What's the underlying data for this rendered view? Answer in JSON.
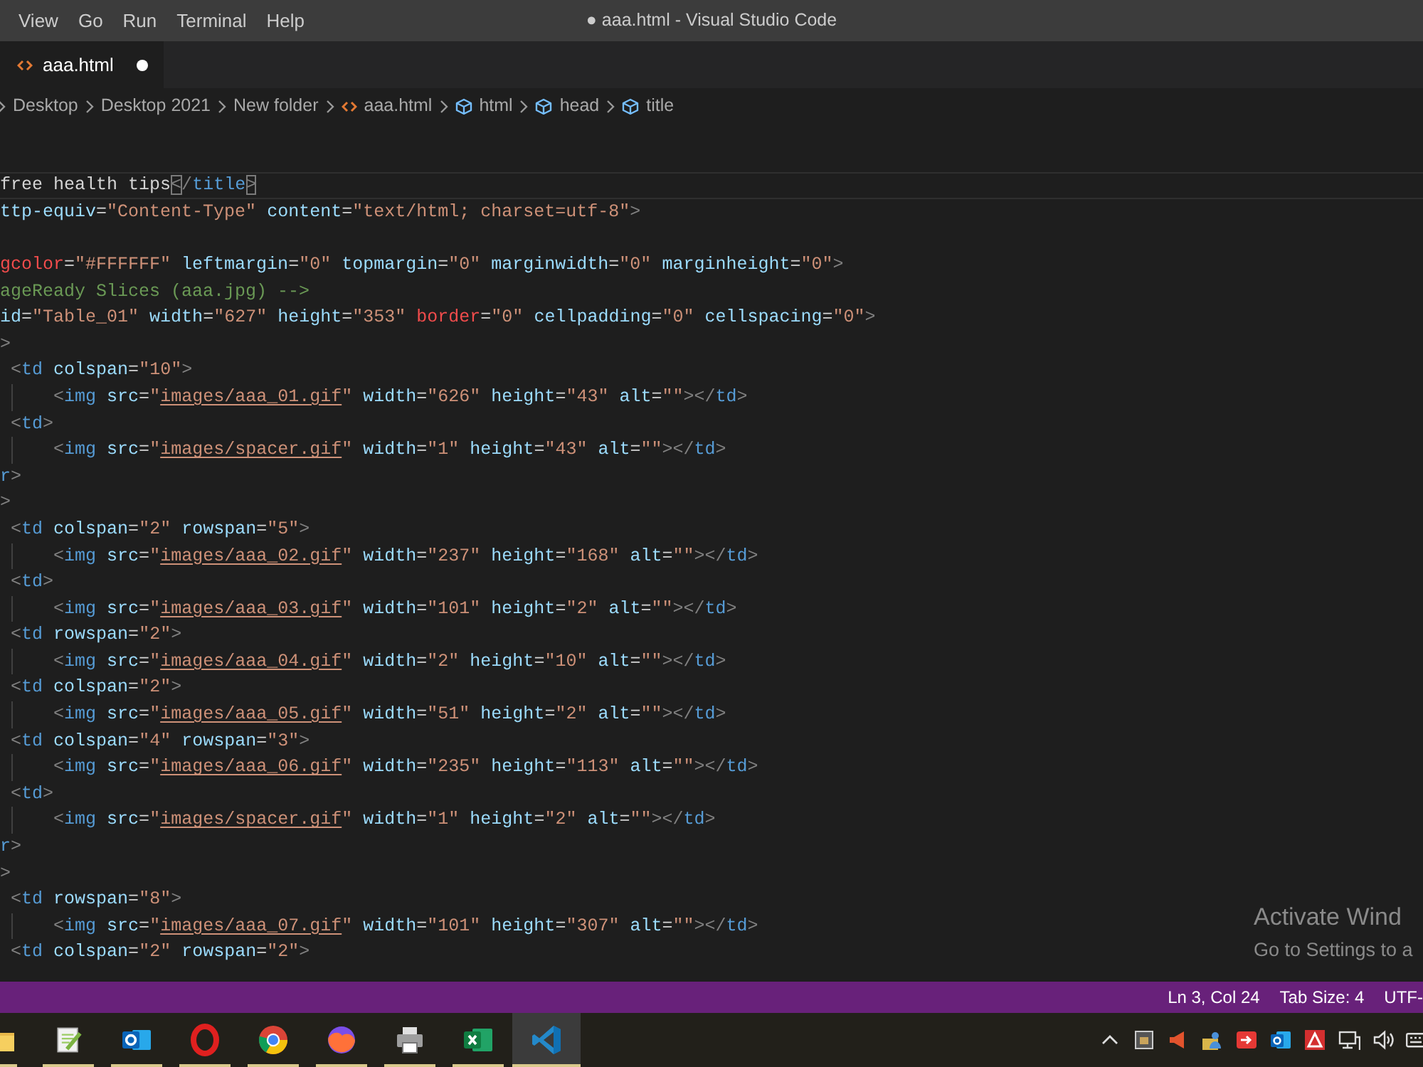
{
  "title_bar": {
    "menu": [
      "View",
      "Go",
      "Run",
      "Terminal",
      "Help"
    ],
    "title": "● aaa.html - Visual Studio Code"
  },
  "tabs": [
    {
      "label": "aaa.html",
      "selected": true,
      "modified": true
    }
  ],
  "breadcrumbs": [
    {
      "label": "Desktop",
      "kind": "folder"
    },
    {
      "label": "Desktop 2021",
      "kind": "folder"
    },
    {
      "label": "New folder",
      "kind": "folder"
    },
    {
      "label": "aaa.html",
      "kind": "file"
    },
    {
      "label": "html",
      "kind": "symbol"
    },
    {
      "label": "head",
      "kind": "symbol"
    },
    {
      "label": "title",
      "kind": "symbol"
    }
  ],
  "editor": {
    "lines": [
      {
        "current": true,
        "tokens": [
          {
            "kind": "text",
            "text": "free health tips"
          },
          {
            "kind": "match",
            "text": "<"
          },
          {
            "kind": "bracket",
            "text": "/"
          },
          {
            "kind": "tag",
            "text": "title"
          },
          {
            "kind": "match",
            "text": ">"
          }
        ]
      },
      {
        "current": false,
        "tokens": [
          {
            "kind": "attr",
            "text": "ttp-equiv"
          },
          {
            "kind": "eq",
            "text": "="
          },
          {
            "kind": "string",
            "text": "\"Content-Type\""
          },
          {
            "kind": "attr",
            "text": " content"
          },
          {
            "kind": "eq",
            "text": "="
          },
          {
            "kind": "string",
            "text": "\"text/html; charset=utf-8\""
          },
          {
            "kind": "bracket",
            "text": ">"
          }
        ]
      },
      {
        "current": false
      },
      {
        "current": false,
        "tokens": [
          {
            "kind": "deprecated",
            "text": "gcolor"
          },
          {
            "kind": "eq",
            "text": "="
          },
          {
            "kind": "string",
            "text": "\"#FFFFFF\""
          },
          {
            "kind": "attr",
            "text": " leftmargin"
          },
          {
            "kind": "eq",
            "text": "="
          },
          {
            "kind": "string",
            "text": "\"0\""
          },
          {
            "kind": "attr",
            "text": " topmargin"
          },
          {
            "kind": "eq",
            "text": "="
          },
          {
            "kind": "string",
            "text": "\"0\""
          },
          {
            "kind": "attr",
            "text": " marginwidth"
          },
          {
            "kind": "eq",
            "text": "="
          },
          {
            "kind": "string",
            "text": "\"0\""
          },
          {
            "kind": "attr",
            "text": " marginheight"
          },
          {
            "kind": "eq",
            "text": "="
          },
          {
            "kind": "string",
            "text": "\"0\""
          },
          {
            "kind": "bracket",
            "text": ">"
          }
        ]
      },
      {
        "current": false,
        "tokens": [
          {
            "kind": "comment",
            "text": "ageReady Slices (aaa.jpg) -->"
          }
        ]
      },
      {
        "current": false,
        "tokens": [
          {
            "kind": "attr",
            "text": "id"
          },
          {
            "kind": "eq",
            "text": "="
          },
          {
            "kind": "string",
            "text": "\"Table_01\""
          },
          {
            "kind": "attr",
            "text": " width"
          },
          {
            "kind": "eq",
            "text": "="
          },
          {
            "kind": "string",
            "text": "\"627\""
          },
          {
            "kind": "attr",
            "text": " height"
          },
          {
            "kind": "eq",
            "text": "="
          },
          {
            "kind": "string",
            "text": "\"353\""
          },
          {
            "kind": "deprecated",
            "text": " border"
          },
          {
            "kind": "eq",
            "text": "="
          },
          {
            "kind": "string",
            "text": "\"0\""
          },
          {
            "kind": "attr",
            "text": " cellpadding"
          },
          {
            "kind": "eq",
            "text": "="
          },
          {
            "kind": "string",
            "text": "\"0\""
          },
          {
            "kind": "attr",
            "text": " cellspacing"
          },
          {
            "kind": "eq",
            "text": "="
          },
          {
            "kind": "string",
            "text": "\"0\""
          },
          {
            "kind": "bracket",
            "text": ">"
          }
        ]
      },
      {
        "current": false,
        "tokens": [
          {
            "kind": "bracket",
            "text": ">"
          }
        ],
        "children": [
          {
            "current": false,
            "tokens": [
              {
                "kind": "bracket",
                "text": "<"
              },
              {
                "kind": "tag",
                "text": "td"
              },
              {
                "kind": "attr",
                "text": " colspan"
              },
              {
                "kind": "eq",
                "text": "="
              },
              {
                "kind": "string",
                "text": "\"10\""
              },
              {
                "kind": "bracket",
                "text": ">"
              }
            ],
            "children": [
              {
                "current": false,
                "tokens": [
                  {
                    "kind": "bracket",
                    "text": "<"
                  },
                  {
                    "kind": "tag",
                    "text": "img"
                  },
                  {
                    "kind": "attr",
                    "text": " src"
                  },
                  {
                    "kind": "eq",
                    "text": "="
                  },
                  {
                    "kind": "string",
                    "text": "\""
                  },
                  {
                    "kind": "link",
                    "text": "images/aaa_01.gif"
                  },
                  {
                    "kind": "string",
                    "text": "\""
                  },
                  {
                    "kind": "attr",
                    "text": " width"
                  },
                  {
                    "kind": "eq",
                    "text": "="
                  },
                  {
                    "kind": "string",
                    "text": "\"626\""
                  },
                  {
                    "kind": "attr",
                    "text": " height"
                  },
                  {
                    "kind": "eq",
                    "text": "="
                  },
                  {
                    "kind": "string",
                    "text": "\"43\""
                  },
                  {
                    "kind": "attr",
                    "text": " alt"
                  },
                  {
                    "kind": "eq",
                    "text": "="
                  },
                  {
                    "kind": "string",
                    "text": "\"\""
                  },
                  {
                    "kind": "bracket",
                    "text": "></"
                  },
                  {
                    "kind": "tag",
                    "text": "td"
                  },
                  {
                    "kind": "bracket",
                    "text": ">"
                  }
                ]
              }
            ]
          },
          {
            "current": false,
            "tokens": [
              {
                "kind": "bracket",
                "text": "<"
              },
              {
                "kind": "tag",
                "text": "td"
              },
              {
                "kind": "bracket",
                "text": ">"
              }
            ],
            "children": [
              {
                "current": false,
                "tokens": [
                  {
                    "kind": "bracket",
                    "text": "<"
                  },
                  {
                    "kind": "tag",
                    "text": "img"
                  },
                  {
                    "kind": "attr",
                    "text": " src"
                  },
                  {
                    "kind": "eq",
                    "text": "="
                  },
                  {
                    "kind": "string",
                    "text": "\""
                  },
                  {
                    "kind": "link",
                    "text": "images/spacer.gif"
                  },
                  {
                    "kind": "string",
                    "text": "\""
                  },
                  {
                    "kind": "attr",
                    "text": " width"
                  },
                  {
                    "kind": "eq",
                    "text": "="
                  },
                  {
                    "kind": "string",
                    "text": "\"1\""
                  },
                  {
                    "kind": "attr",
                    "text": " height"
                  },
                  {
                    "kind": "eq",
                    "text": "="
                  },
                  {
                    "kind": "string",
                    "text": "\"43\""
                  },
                  {
                    "kind": "attr",
                    "text": " alt"
                  },
                  {
                    "kind": "eq",
                    "text": "="
                  },
                  {
                    "kind": "string",
                    "text": "\"\""
                  },
                  {
                    "kind": "bracket",
                    "text": "></"
                  },
                  {
                    "kind": "tag",
                    "text": "td"
                  },
                  {
                    "kind": "bracket",
                    "text": ">"
                  }
                ]
              }
            ]
          }
        ]
      },
      {
        "current": false,
        "tokens": [
          {
            "kind": "tag",
            "text": "r"
          },
          {
            "kind": "bracket",
            "text": ">"
          }
        ]
      },
      {
        "current": false,
        "tokens": [
          {
            "kind": "bracket",
            "text": ">"
          }
        ],
        "children": [
          {
            "current": false,
            "tokens": [
              {
                "kind": "bracket",
                "text": "<"
              },
              {
                "kind": "tag",
                "text": "td"
              },
              {
                "kind": "attr",
                "text": " colspan"
              },
              {
                "kind": "eq",
                "text": "="
              },
              {
                "kind": "string",
                "text": "\"2\""
              },
              {
                "kind": "attr",
                "text": " rowspan"
              },
              {
                "kind": "eq",
                "text": "="
              },
              {
                "kind": "string",
                "text": "\"5\""
              },
              {
                "kind": "bracket",
                "text": ">"
              }
            ],
            "children": [
              {
                "current": false,
                "tokens": [
                  {
                    "kind": "bracket",
                    "text": "<"
                  },
                  {
                    "kind": "tag",
                    "text": "img"
                  },
                  {
                    "kind": "attr",
                    "text": " src"
                  },
                  {
                    "kind": "eq",
                    "text": "="
                  },
                  {
                    "kind": "string",
                    "text": "\""
                  },
                  {
                    "kind": "link",
                    "text": "images/aaa_02.gif"
                  },
                  {
                    "kind": "string",
                    "text": "\""
                  },
                  {
                    "kind": "attr",
                    "text": " width"
                  },
                  {
                    "kind": "eq",
                    "text": "="
                  },
                  {
                    "kind": "string",
                    "text": "\"237\""
                  },
                  {
                    "kind": "attr",
                    "text": " height"
                  },
                  {
                    "kind": "eq",
                    "text": "="
                  },
                  {
                    "kind": "string",
                    "text": "\"168\""
                  },
                  {
                    "kind": "attr",
                    "text": " alt"
                  },
                  {
                    "kind": "eq",
                    "text": "="
                  },
                  {
                    "kind": "string",
                    "text": "\"\""
                  },
                  {
                    "kind": "bracket",
                    "text": "></"
                  },
                  {
                    "kind": "tag",
                    "text": "td"
                  },
                  {
                    "kind": "bracket",
                    "text": ">"
                  }
                ]
              }
            ]
          },
          {
            "current": false,
            "tokens": [
              {
                "kind": "bracket",
                "text": "<"
              },
              {
                "kind": "tag",
                "text": "td"
              },
              {
                "kind": "bracket",
                "text": ">"
              }
            ],
            "children": [
              {
                "current": false,
                "tokens": [
                  {
                    "kind": "bracket",
                    "text": "<"
                  },
                  {
                    "kind": "tag",
                    "text": "img"
                  },
                  {
                    "kind": "attr",
                    "text": " src"
                  },
                  {
                    "kind": "eq",
                    "text": "="
                  },
                  {
                    "kind": "string",
                    "text": "\""
                  },
                  {
                    "kind": "link",
                    "text": "images/aaa_03.gif"
                  },
                  {
                    "kind": "string",
                    "text": "\""
                  },
                  {
                    "kind": "attr",
                    "text": " width"
                  },
                  {
                    "kind": "eq",
                    "text": "="
                  },
                  {
                    "kind": "string",
                    "text": "\"101\""
                  },
                  {
                    "kind": "attr",
                    "text": " height"
                  },
                  {
                    "kind": "eq",
                    "text": "="
                  },
                  {
                    "kind": "string",
                    "text": "\"2\""
                  },
                  {
                    "kind": "attr",
                    "text": " alt"
                  },
                  {
                    "kind": "eq",
                    "text": "="
                  },
                  {
                    "kind": "string",
                    "text": "\"\""
                  },
                  {
                    "kind": "bracket",
                    "text": "></"
                  },
                  {
                    "kind": "tag",
                    "text": "td"
                  },
                  {
                    "kind": "bracket",
                    "text": ">"
                  }
                ]
              }
            ]
          },
          {
            "current": false,
            "tokens": [
              {
                "kind": "bracket",
                "text": "<"
              },
              {
                "kind": "tag",
                "text": "td"
              },
              {
                "kind": "attr",
                "text": " rowspan"
              },
              {
                "kind": "eq",
                "text": "="
              },
              {
                "kind": "string",
                "text": "\"2\""
              },
              {
                "kind": "bracket",
                "text": ">"
              }
            ],
            "children": [
              {
                "current": false,
                "tokens": [
                  {
                    "kind": "bracket",
                    "text": "<"
                  },
                  {
                    "kind": "tag",
                    "text": "img"
                  },
                  {
                    "kind": "attr",
                    "text": " src"
                  },
                  {
                    "kind": "eq",
                    "text": "="
                  },
                  {
                    "kind": "string",
                    "text": "\""
                  },
                  {
                    "kind": "link",
                    "text": "images/aaa_04.gif"
                  },
                  {
                    "kind": "string",
                    "text": "\""
                  },
                  {
                    "kind": "attr",
                    "text": " width"
                  },
                  {
                    "kind": "eq",
                    "text": "="
                  },
                  {
                    "kind": "string",
                    "text": "\"2\""
                  },
                  {
                    "kind": "attr",
                    "text": " height"
                  },
                  {
                    "kind": "eq",
                    "text": "="
                  },
                  {
                    "kind": "string",
                    "text": "\"10\""
                  },
                  {
                    "kind": "attr",
                    "text": " alt"
                  },
                  {
                    "kind": "eq",
                    "text": "="
                  },
                  {
                    "kind": "string",
                    "text": "\"\""
                  },
                  {
                    "kind": "bracket",
                    "text": "></"
                  },
                  {
                    "kind": "tag",
                    "text": "td"
                  },
                  {
                    "kind": "bracket",
                    "text": ">"
                  }
                ]
              }
            ]
          },
          {
            "current": false,
            "tokens": [
              {
                "kind": "bracket",
                "text": "<"
              },
              {
                "kind": "tag",
                "text": "td"
              },
              {
                "kind": "attr",
                "text": " colspan"
              },
              {
                "kind": "eq",
                "text": "="
              },
              {
                "kind": "string",
                "text": "\"2\""
              },
              {
                "kind": "bracket",
                "text": ">"
              }
            ],
            "children": [
              {
                "current": false,
                "tokens": [
                  {
                    "kind": "bracket",
                    "text": "<"
                  },
                  {
                    "kind": "tag",
                    "text": "img"
                  },
                  {
                    "kind": "attr",
                    "text": " src"
                  },
                  {
                    "kind": "eq",
                    "text": "="
                  },
                  {
                    "kind": "string",
                    "text": "\""
                  },
                  {
                    "kind": "link",
                    "text": "images/aaa_05.gif"
                  },
                  {
                    "kind": "string",
                    "text": "\""
                  },
                  {
                    "kind": "attr",
                    "text": " width"
                  },
                  {
                    "kind": "eq",
                    "text": "="
                  },
                  {
                    "kind": "string",
                    "text": "\"51\""
                  },
                  {
                    "kind": "attr",
                    "text": " height"
                  },
                  {
                    "kind": "eq",
                    "text": "="
                  },
                  {
                    "kind": "string",
                    "text": "\"2\""
                  },
                  {
                    "kind": "attr",
                    "text": " alt"
                  },
                  {
                    "kind": "eq",
                    "text": "="
                  },
                  {
                    "kind": "string",
                    "text": "\"\""
                  },
                  {
                    "kind": "bracket",
                    "text": "></"
                  },
                  {
                    "kind": "tag",
                    "text": "td"
                  },
                  {
                    "kind": "bracket",
                    "text": ">"
                  }
                ]
              }
            ]
          },
          {
            "current": false,
            "tokens": [
              {
                "kind": "bracket",
                "text": "<"
              },
              {
                "kind": "tag",
                "text": "td"
              },
              {
                "kind": "attr",
                "text": " colspan"
              },
              {
                "kind": "eq",
                "text": "="
              },
              {
                "kind": "string",
                "text": "\"4\""
              },
              {
                "kind": "attr",
                "text": " rowspan"
              },
              {
                "kind": "eq",
                "text": "="
              },
              {
                "kind": "string",
                "text": "\"3\""
              },
              {
                "kind": "bracket",
                "text": ">"
              }
            ],
            "children": [
              {
                "current": false,
                "tokens": [
                  {
                    "kind": "bracket",
                    "text": "<"
                  },
                  {
                    "kind": "tag",
                    "text": "img"
                  },
                  {
                    "kind": "attr",
                    "text": " src"
                  },
                  {
                    "kind": "eq",
                    "text": "="
                  },
                  {
                    "kind": "string",
                    "text": "\""
                  },
                  {
                    "kind": "link",
                    "text": "images/aaa_06.gif"
                  },
                  {
                    "kind": "string",
                    "text": "\""
                  },
                  {
                    "kind": "attr",
                    "text": " width"
                  },
                  {
                    "kind": "eq",
                    "text": "="
                  },
                  {
                    "kind": "string",
                    "text": "\"235\""
                  },
                  {
                    "kind": "attr",
                    "text": " height"
                  },
                  {
                    "kind": "eq",
                    "text": "="
                  },
                  {
                    "kind": "string",
                    "text": "\"113\""
                  },
                  {
                    "kind": "attr",
                    "text": " alt"
                  },
                  {
                    "kind": "eq",
                    "text": "="
                  },
                  {
                    "kind": "string",
                    "text": "\"\""
                  },
                  {
                    "kind": "bracket",
                    "text": "></"
                  },
                  {
                    "kind": "tag",
                    "text": "td"
                  },
                  {
                    "kind": "bracket",
                    "text": ">"
                  }
                ]
              }
            ]
          },
          {
            "current": false,
            "tokens": [
              {
                "kind": "bracket",
                "text": "<"
              },
              {
                "kind": "tag",
                "text": "td"
              },
              {
                "kind": "bracket",
                "text": ">"
              }
            ],
            "children": [
              {
                "current": false,
                "tokens": [
                  {
                    "kind": "bracket",
                    "text": "<"
                  },
                  {
                    "kind": "tag",
                    "text": "img"
                  },
                  {
                    "kind": "attr",
                    "text": " src"
                  },
                  {
                    "kind": "eq",
                    "text": "="
                  },
                  {
                    "kind": "string",
                    "text": "\""
                  },
                  {
                    "kind": "link",
                    "text": "images/spacer.gif"
                  },
                  {
                    "kind": "string",
                    "text": "\""
                  },
                  {
                    "kind": "attr",
                    "text": " width"
                  },
                  {
                    "kind": "eq",
                    "text": "="
                  },
                  {
                    "kind": "string",
                    "text": "\"1\""
                  },
                  {
                    "kind": "attr",
                    "text": " height"
                  },
                  {
                    "kind": "eq",
                    "text": "="
                  },
                  {
                    "kind": "string",
                    "text": "\"2\""
                  },
                  {
                    "kind": "attr",
                    "text": " alt"
                  },
                  {
                    "kind": "eq",
                    "text": "="
                  },
                  {
                    "kind": "string",
                    "text": "\"\""
                  },
                  {
                    "kind": "bracket",
                    "text": "></"
                  },
                  {
                    "kind": "tag",
                    "text": "td"
                  },
                  {
                    "kind": "bracket",
                    "text": ">"
                  }
                ]
              }
            ]
          }
        ]
      },
      {
        "current": false,
        "tokens": [
          {
            "kind": "tag",
            "text": "r"
          },
          {
            "kind": "bracket",
            "text": ">"
          }
        ]
      },
      {
        "current": false,
        "tokens": [
          {
            "kind": "bracket",
            "text": ">"
          }
        ],
        "children": [
          {
            "current": false,
            "tokens": [
              {
                "kind": "bracket",
                "text": "<"
              },
              {
                "kind": "tag",
                "text": "td"
              },
              {
                "kind": "attr",
                "text": " rowspan"
              },
              {
                "kind": "eq",
                "text": "="
              },
              {
                "kind": "string",
                "text": "\"8\""
              },
              {
                "kind": "bracket",
                "text": ">"
              }
            ],
            "children": [
              {
                "current": false,
                "tokens": [
                  {
                    "kind": "bracket",
                    "text": "<"
                  },
                  {
                    "kind": "tag",
                    "text": "img"
                  },
                  {
                    "kind": "attr",
                    "text": " src"
                  },
                  {
                    "kind": "eq",
                    "text": "="
                  },
                  {
                    "kind": "string",
                    "text": "\""
                  },
                  {
                    "kind": "link",
                    "text": "images/aaa_07.gif"
                  },
                  {
                    "kind": "string",
                    "text": "\""
                  },
                  {
                    "kind": "attr",
                    "text": " width"
                  },
                  {
                    "kind": "eq",
                    "text": "="
                  },
                  {
                    "kind": "string",
                    "text": "\"101\""
                  },
                  {
                    "kind": "attr",
                    "text": " height"
                  },
                  {
                    "kind": "eq",
                    "text": "="
                  },
                  {
                    "kind": "string",
                    "text": "\"307\""
                  },
                  {
                    "kind": "attr",
                    "text": " alt"
                  },
                  {
                    "kind": "eq",
                    "text": "="
                  },
                  {
                    "kind": "string",
                    "text": "\"\""
                  },
                  {
                    "kind": "bracket",
                    "text": "></"
                  },
                  {
                    "kind": "tag",
                    "text": "td"
                  },
                  {
                    "kind": "bracket",
                    "text": ">"
                  }
                ]
              }
            ]
          },
          {
            "current": false,
            "tokens": [
              {
                "kind": "bracket",
                "text": "<"
              },
              {
                "kind": "tag",
                "text": "td"
              },
              {
                "kind": "attr",
                "text": " colspan"
              },
              {
                "kind": "eq",
                "text": "="
              },
              {
                "kind": "string",
                "text": "\"2\""
              },
              {
                "kind": "attr",
                "text": " rowspan"
              },
              {
                "kind": "eq",
                "text": "="
              },
              {
                "kind": "string",
                "text": "\"2\""
              },
              {
                "kind": "bracket",
                "text": ">"
              }
            ]
          }
        ]
      }
    ]
  },
  "activation_notice": {
    "title": "Activate Wind",
    "text": "Go to Settings to a"
  },
  "status_bar": {
    "items": [
      "Ln 3, Col 24",
      "Tab Size: 4",
      "UTF-"
    ]
  },
  "taskbar": {
    "apps": [
      {
        "kind": "folder",
        "running": true,
        "selected": false
      },
      {
        "kind": "notepad",
        "running": true,
        "selected": false
      },
      {
        "kind": "mail",
        "running": true,
        "selected": false
      },
      {
        "kind": "ring",
        "running": true,
        "selected": false
      },
      {
        "kind": "wheel",
        "running": true,
        "selected": false
      },
      {
        "kind": "globe",
        "running": true,
        "selected": false
      },
      {
        "kind": "printer",
        "running": true,
        "selected": false
      },
      {
        "kind": "sheet",
        "running": true,
        "selected": false
      },
      {
        "kind": "ribbon",
        "running": true,
        "selected": true
      }
    ]
  }
}
